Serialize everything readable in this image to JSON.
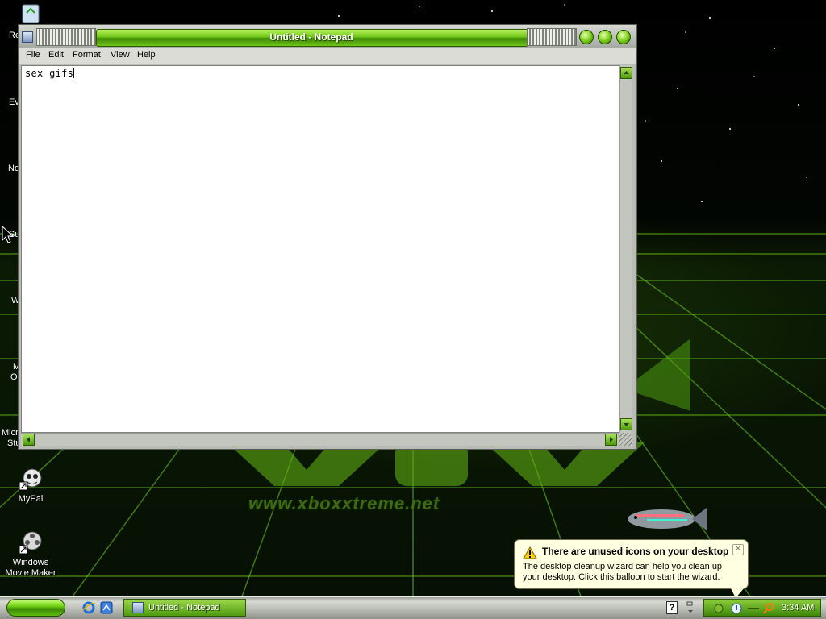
{
  "desktop": {
    "watermark": "www.xboxxtreme.net",
    "icons": [
      {
        "label": "MyPal",
        "name": "mypal"
      },
      {
        "label": "Windows Movie Maker",
        "name": "windows-movie-maker"
      }
    ],
    "partial_labels": [
      "Re",
      "Ev",
      "No",
      "Su",
      "W",
      "M",
      "O",
      "Micro",
      "Stu"
    ]
  },
  "notepad": {
    "title": "Untitled - Notepad",
    "menu": [
      "File",
      "Edit",
      "Format",
      "View",
      "Help"
    ],
    "content": "sex gifs"
  },
  "balloon": {
    "title": "There are unused icons on your desktop",
    "body": "The desktop cleanup wizard can help you clean up your desktop. Click this balloon to start the wizard.",
    "close": "×"
  },
  "taskbar": {
    "tasks": [
      {
        "label": "Untitled - Notepad"
      }
    ],
    "help_icon": "?",
    "clock": "3:34 AM"
  },
  "colors": {
    "accent": "#6fc618",
    "balloon_bg": "#ffffe1"
  }
}
